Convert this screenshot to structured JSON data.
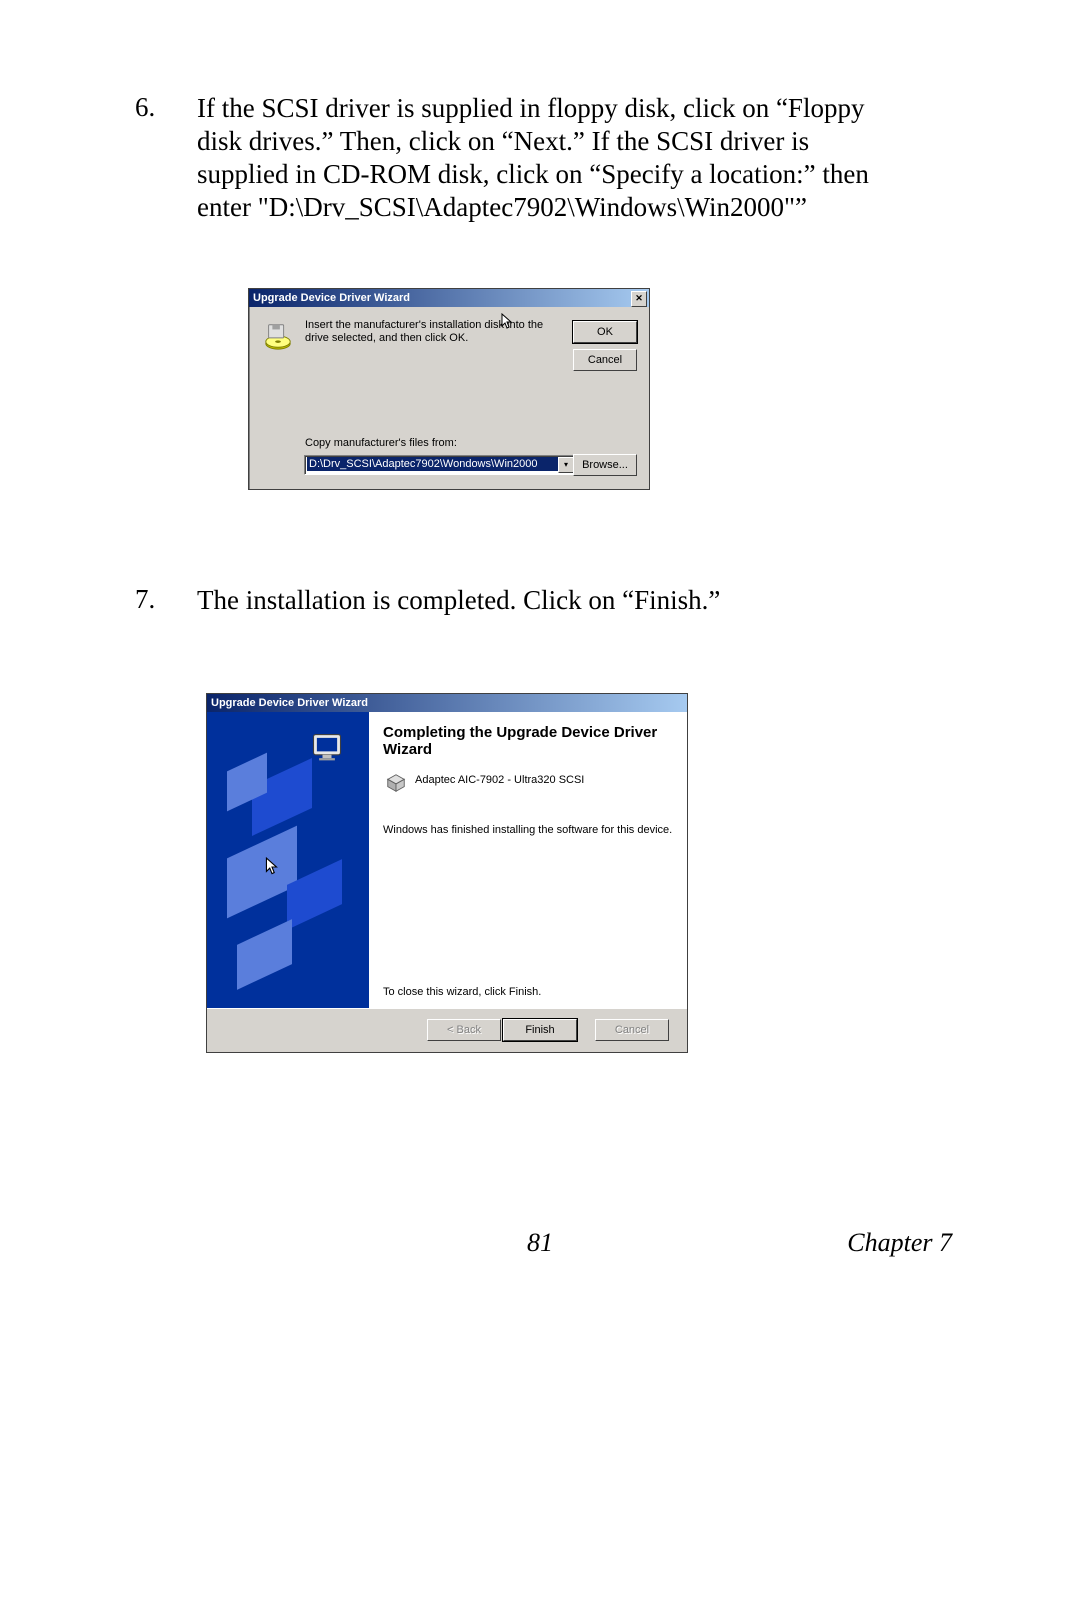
{
  "steps": {
    "six": {
      "num": "6.",
      "text": "If the SCSI driver is supplied in floppy disk, click on “Floppy disk drives.” Then, click on “Next.” If the SCSI driver is supplied in CD-ROM disk, click on “Specify a location:” then enter \"D:\\Drv_SCSI\\Adaptec7902\\Windows\\Win2000\"”"
    },
    "seven": {
      "num": "7.",
      "text": "The installation is completed. Click on “Finish.”"
    }
  },
  "dialog1": {
    "title": "Upgrade Device Driver Wizard",
    "message": "Insert the manufacturer's installation disk into the drive selected, and then click OK.",
    "copy_label": "Copy manufacturer's files from:",
    "path_value": "D:\\Drv_SCSI\\Adaptec7902\\Wondows\\Win2000",
    "ok": "OK",
    "cancel": "Cancel",
    "browse": "Browse..."
  },
  "dialog2": {
    "title": "Upgrade Device Driver Wizard",
    "heading": "Completing the Upgrade Device Driver Wizard",
    "device": "Adaptec AIC-7902 - Ultra320 SCSI",
    "finished_msg": "Windows has finished installing the software for this device.",
    "close_msg": "To close this wizard, click Finish.",
    "back": "< Back",
    "finish": "Finish",
    "cancel": "Cancel"
  },
  "footer": {
    "page": "81",
    "chapter": "Chapter 7"
  }
}
